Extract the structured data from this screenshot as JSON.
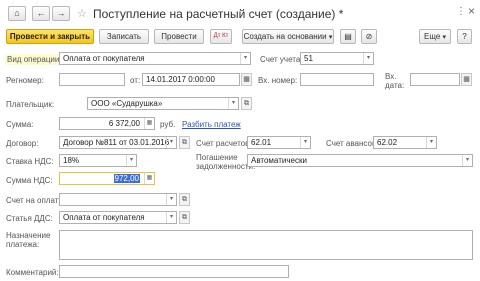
{
  "window": {
    "title": "Поступление на расчетный счет (создание) *",
    "more_icon": "⋮",
    "close_icon": "×"
  },
  "nav": {
    "home_icon": "⌂",
    "back_icon": "←",
    "forward_icon": "→",
    "star_icon": "☆"
  },
  "toolbar": {
    "post_and_close": "Провести и закрыть",
    "save": "Записать",
    "post": "Провести",
    "dt_kt": "Дт Кт",
    "create_based_on": "Создать на основании",
    "more": "Еще",
    "help": "?",
    "doc_icon": "▤",
    "attach_icon": "⊘"
  },
  "form": {
    "operation": {
      "label": "Вид операции:",
      "value": "Оплата от покупателя"
    },
    "account": {
      "label": "Счет учета:",
      "value": "51"
    },
    "regnumber": {
      "label": "Регномер:",
      "value": ""
    },
    "date": {
      "label": "от:",
      "value": "14.01.2017  0:00:00"
    },
    "in_number": {
      "label": "Вх. номер:",
      "value": ""
    },
    "in_date": {
      "label": "Вх. дата:",
      "value": ""
    },
    "payer": {
      "label": "Плательщик:",
      "value": "ООО «Сударушка»"
    },
    "amount": {
      "label": "Сумма:",
      "value": "6 372,00",
      "currency": "руб.",
      "split_link": "Разбить платеж"
    },
    "contract": {
      "label": "Договор:",
      "value": "Договор №811 от 03.01.2016"
    },
    "settlement_account": {
      "label": "Счет расчетов:",
      "value": "62.01"
    },
    "advance_account": {
      "label": "Счет авансов:",
      "value": "62.02"
    },
    "vat_rate": {
      "label": "Ставка НДС:",
      "value": "18%"
    },
    "repayment": {
      "label": "Погашение задолженности:",
      "value": "Автоматически"
    },
    "vat_amount": {
      "label": "Сумма НДС:",
      "value": "972,00"
    },
    "invoice": {
      "label": "Счет на оплату:",
      "value": ""
    },
    "dds_item": {
      "label": "Статья ДДС:",
      "value": "Оплата от покупателя"
    },
    "purpose": {
      "label": "Назначение платежа:",
      "value": ""
    },
    "comment": {
      "label": "Комментарий:",
      "value": ""
    }
  },
  "icons": {
    "dropdown": "▾",
    "open": "⧉",
    "calendar": "▦",
    "calc": "▦",
    "chevron": "▸"
  }
}
